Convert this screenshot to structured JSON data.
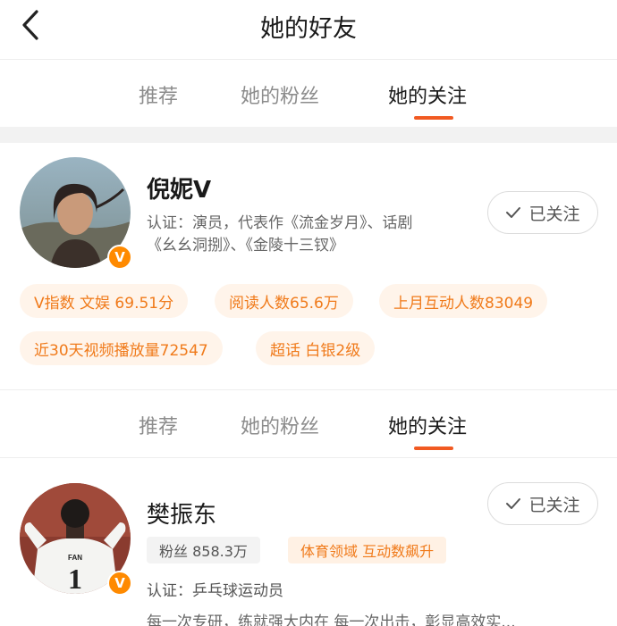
{
  "header": {
    "title": "她的好友"
  },
  "tabs": [
    {
      "label": "推荐",
      "active": false
    },
    {
      "label": "她的粉丝",
      "active": false
    },
    {
      "label": "她的关注",
      "active": true
    }
  ],
  "users": [
    {
      "name": "倪妮V",
      "verified_badge": "V",
      "description_line1": "认证：演员，代表作《流金岁月》、话剧",
      "description_line2": "《幺幺洞捌》、《金陵十三钗》",
      "follow_label": "已关注",
      "tags": [
        "V指数 文娱 69.51分",
        "阅读人数65.6万",
        "上月互动人数83049",
        "近30天视频播放量72547",
        "超话 白银2级"
      ]
    },
    {
      "name": "樊振东",
      "verified_badge": "V",
      "fans_chip": "粉丝 858.3万",
      "field_chip": "体育领域 互动数飙升",
      "certification": "认证：乒乓球运动员",
      "bio": "每一次专研，练就强大内在 每一次出击，彰显高效实...",
      "follow_label": "已关注",
      "jersey_text": "FAN",
      "jersey_number": "1"
    }
  ],
  "colors": {
    "accent": "#f15a22",
    "tag_text": "#f07a1a",
    "tag_bg": "#fff4ea",
    "badge": "#ff8a00"
  },
  "icons": {
    "back": "chevron-left-icon",
    "check": "check-icon"
  }
}
